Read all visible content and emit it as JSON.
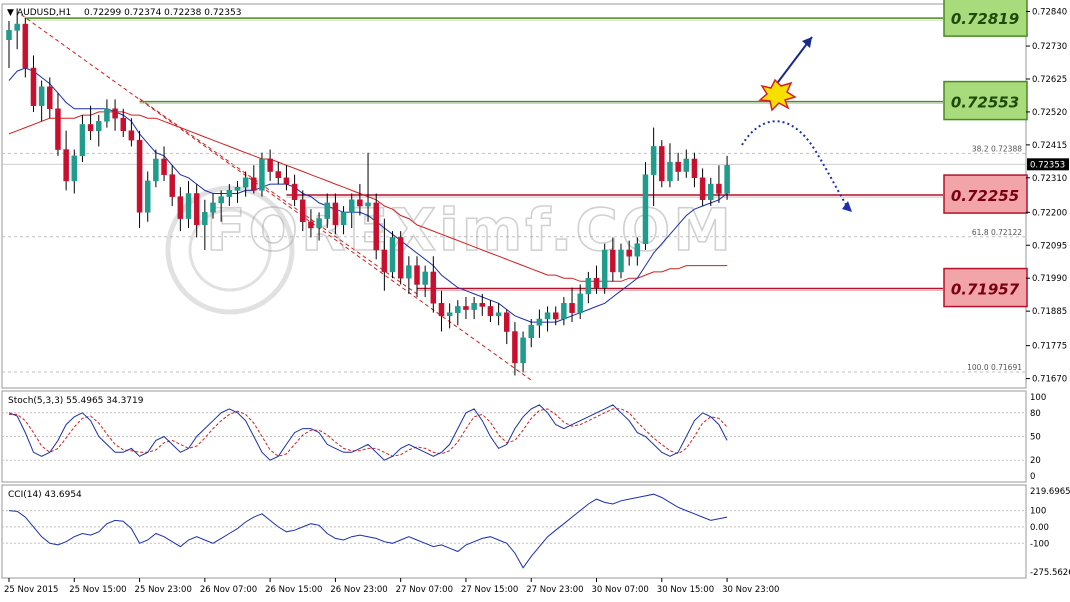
{
  "header": {
    "symbol": "AUDUSD,H1",
    "ohlc": "0.72299 0.72374 0.72238 0.72353"
  },
  "colors": {
    "bull_candle": "#1f9c8c",
    "bear_candle": "#c8102e",
    "ma_fast": "#1c2fae",
    "ma_slow": "#d42020",
    "resistance_line": "#4a8a1e",
    "resistance_box_fill": "#a8db7c",
    "support_line": "#b3122a",
    "support_box_fill": "#f2a5a8",
    "stoch_main": "#1c2fae",
    "stoch_signal": "#d42020",
    "cci_line": "#1c2fae",
    "arrow_up": "#1a2a8a",
    "arrow_down": "#1c2fae",
    "watermark": "#9a9a9a"
  },
  "levels": [
    {
      "label": "0.72819",
      "kind": "resistance"
    },
    {
      "label": "0.72553",
      "kind": "resistance"
    },
    {
      "label": "0.72255",
      "kind": "support"
    },
    {
      "label": "0.71957",
      "kind": "support"
    }
  ],
  "current_price": "0.72353",
  "fibonacci": [
    {
      "level": "38.2",
      "price": "0.72388"
    },
    {
      "level": "61.8",
      "price": "0.72122"
    },
    {
      "level": "100.0",
      "price": "0.71691"
    }
  ],
  "watermark": "FOREXimf.COM",
  "stoch": {
    "title": "Stoch(5,3,3) 55.4965 34.3719",
    "ticks": [
      "100",
      "80",
      "50",
      "20",
      "0"
    ]
  },
  "cci": {
    "title": "CCI(14) 43.6954",
    "ticks": [
      "219.6965",
      "100",
      "0.00",
      "-100",
      "-275.5626"
    ]
  },
  "chart_data": {
    "type": "line",
    "symbol": "AUDUSD",
    "timeframe": "H1",
    "price_ticks": [
      "0.72840",
      "0.72730",
      "0.72625",
      "0.72520",
      "0.72415",
      "0.72310",
      "0.72200",
      "0.72095",
      "0.71990",
      "0.71885",
      "0.71775",
      "0.71670"
    ],
    "ylim": [
      0.7164,
      0.72864
    ],
    "x_labels": [
      "25 Nov 2015",
      "25 Nov 15:00",
      "25 Nov 23:00",
      "26 Nov 07:00",
      "26 Nov 15:00",
      "26 Nov 23:00",
      "27 Nov 07:00",
      "27 Nov 15:00",
      "27 Nov 23:00",
      "30 Nov 07:00",
      "30 Nov 15:00",
      "30 Nov 23:00"
    ],
    "x_label_bars": [
      0,
      8,
      16,
      24,
      32,
      40,
      48,
      56,
      64,
      72,
      80,
      88
    ],
    "candles": [
      [
        0.7275,
        0.7281,
        0.7266,
        0.7278
      ],
      [
        0.7278,
        0.7285,
        0.7272,
        0.728
      ],
      [
        0.728,
        0.7282,
        0.7263,
        0.7266
      ],
      [
        0.7266,
        0.727,
        0.7252,
        0.7254
      ],
      [
        0.7254,
        0.7262,
        0.7249,
        0.726
      ],
      [
        0.726,
        0.7263,
        0.725,
        0.7253
      ],
      [
        0.7253,
        0.7258,
        0.7238,
        0.724
      ],
      [
        0.724,
        0.7246,
        0.7227,
        0.723
      ],
      [
        0.723,
        0.724,
        0.7226,
        0.7238
      ],
      [
        0.7238,
        0.7251,
        0.7236,
        0.7248
      ],
      [
        0.7248,
        0.7254,
        0.7243,
        0.7246
      ],
      [
        0.7246,
        0.7251,
        0.7241,
        0.7249
      ],
      [
        0.7249,
        0.7256,
        0.7247,
        0.7253
      ],
      [
        0.7253,
        0.7256,
        0.7246,
        0.725
      ],
      [
        0.725,
        0.7253,
        0.7244,
        0.7246
      ],
      [
        0.7246,
        0.725,
        0.7241,
        0.7243
      ],
      [
        0.7243,
        0.7246,
        0.7215,
        0.722
      ],
      [
        0.722,
        0.7233,
        0.7217,
        0.723
      ],
      [
        0.723,
        0.724,
        0.7228,
        0.7237
      ],
      [
        0.7237,
        0.7241,
        0.723,
        0.7232
      ],
      [
        0.7232,
        0.7235,
        0.7222,
        0.7225
      ],
      [
        0.7225,
        0.7228,
        0.7214,
        0.7218
      ],
      [
        0.7218,
        0.723,
        0.7215,
        0.7226
      ],
      [
        0.7226,
        0.7229,
        0.7212,
        0.7216
      ],
      [
        0.7216,
        0.7224,
        0.7208,
        0.722
      ],
      [
        0.722,
        0.7226,
        0.7218,
        0.7223
      ],
      [
        0.7223,
        0.7227,
        0.7217,
        0.7225
      ],
      [
        0.7225,
        0.7229,
        0.7222,
        0.7227
      ],
      [
        0.7227,
        0.723,
        0.7223,
        0.7228
      ],
      [
        0.7228,
        0.7233,
        0.7225,
        0.7231
      ],
      [
        0.7231,
        0.7235,
        0.7226,
        0.7227
      ],
      [
        0.7227,
        0.7239,
        0.7225,
        0.7237
      ],
      [
        0.7237,
        0.724,
        0.723,
        0.7233
      ],
      [
        0.7233,
        0.7236,
        0.7229,
        0.7231
      ],
      [
        0.7231,
        0.7235,
        0.7227,
        0.7229
      ],
      [
        0.7229,
        0.7232,
        0.7222,
        0.7224
      ],
      [
        0.7224,
        0.7227,
        0.7214,
        0.7217
      ],
      [
        0.7217,
        0.7221,
        0.7212,
        0.7215
      ],
      [
        0.7215,
        0.722,
        0.7211,
        0.7218
      ],
      [
        0.7218,
        0.7226,
        0.7215,
        0.7223
      ],
      [
        0.7223,
        0.7226,
        0.7213,
        0.7216
      ],
      [
        0.7216,
        0.7222,
        0.7213,
        0.722
      ],
      [
        0.722,
        0.7226,
        0.7215,
        0.7224
      ],
      [
        0.7224,
        0.7229,
        0.7219,
        0.7222
      ],
      [
        0.7222,
        0.7239,
        0.7217,
        0.7223
      ],
      [
        0.7223,
        0.7226,
        0.7205,
        0.7208
      ],
      [
        0.7208,
        0.7218,
        0.7195,
        0.7201
      ],
      [
        0.7201,
        0.7214,
        0.7199,
        0.7212
      ],
      [
        0.7212,
        0.7214,
        0.7197,
        0.7199
      ],
      [
        0.7199,
        0.7206,
        0.7194,
        0.7203
      ],
      [
        0.7203,
        0.7206,
        0.7193,
        0.7197
      ],
      [
        0.7197,
        0.7203,
        0.7193,
        0.7201
      ],
      [
        0.7201,
        0.7206,
        0.7188,
        0.7191
      ],
      [
        0.7191,
        0.7195,
        0.7182,
        0.7187
      ],
      [
        0.7187,
        0.7191,
        0.7183,
        0.7188
      ],
      [
        0.7188,
        0.7192,
        0.7184,
        0.719
      ],
      [
        0.719,
        0.7193,
        0.7186,
        0.7189
      ],
      [
        0.7189,
        0.7193,
        0.7186,
        0.7191
      ],
      [
        0.7191,
        0.7194,
        0.7187,
        0.719
      ],
      [
        0.719,
        0.7192,
        0.7185,
        0.7187
      ],
      [
        0.7187,
        0.7191,
        0.7184,
        0.7188
      ],
      [
        0.7188,
        0.7189,
        0.7178,
        0.7182
      ],
      [
        0.7182,
        0.7185,
        0.7168,
        0.7172
      ],
      [
        0.7172,
        0.7182,
        0.7169,
        0.718
      ],
      [
        0.718,
        0.7186,
        0.7177,
        0.7184
      ],
      [
        0.7184,
        0.7189,
        0.718,
        0.7186
      ],
      [
        0.7186,
        0.719,
        0.7182,
        0.7188
      ],
      [
        0.7188,
        0.719,
        0.7184,
        0.7186
      ],
      [
        0.7186,
        0.7193,
        0.7184,
        0.7191
      ],
      [
        0.7191,
        0.7196,
        0.7185,
        0.7188
      ],
      [
        0.7188,
        0.7197,
        0.7186,
        0.7194
      ],
      [
        0.7194,
        0.7201,
        0.7191,
        0.7199
      ],
      [
        0.7199,
        0.7203,
        0.7194,
        0.7196
      ],
      [
        0.7196,
        0.721,
        0.7194,
        0.7208
      ],
      [
        0.7208,
        0.7212,
        0.7198,
        0.7201
      ],
      [
        0.7201,
        0.721,
        0.7199,
        0.7208
      ],
      [
        0.7208,
        0.7211,
        0.7203,
        0.7206
      ],
      [
        0.7206,
        0.7212,
        0.7203,
        0.721
      ],
      [
        0.721,
        0.7236,
        0.7208,
        0.7232
      ],
      [
        0.7232,
        0.7247,
        0.7222,
        0.7241
      ],
      [
        0.7241,
        0.7243,
        0.7228,
        0.723
      ],
      [
        0.723,
        0.7242,
        0.7228,
        0.7236
      ],
      [
        0.7236,
        0.7239,
        0.723,
        0.7233
      ],
      [
        0.7233,
        0.724,
        0.7231,
        0.7237
      ],
      [
        0.7237,
        0.7239,
        0.7228,
        0.7231
      ],
      [
        0.7231,
        0.7234,
        0.7222,
        0.7224
      ],
      [
        0.7224,
        0.7231,
        0.7222,
        0.7229
      ],
      [
        0.7229,
        0.7235,
        0.7223,
        0.7226
      ],
      [
        0.7226,
        0.7238,
        0.7224,
        0.7235
      ]
    ],
    "ma_fast": [
      0.7262,
      0.7265,
      0.7266,
      0.7265,
      0.7263,
      0.7261,
      0.7258,
      0.7255,
      0.7253,
      0.7253,
      0.7253,
      0.7253,
      0.7253,
      0.7252,
      0.7251,
      0.7249,
      0.7245,
      0.7242,
      0.7239,
      0.7238,
      0.7235,
      0.7232,
      0.7231,
      0.7229,
      0.7227,
      0.7226,
      0.7226,
      0.7226,
      0.7226,
      0.7227,
      0.7227,
      0.7228,
      0.7229,
      0.7229,
      0.7229,
      0.7228,
      0.7226,
      0.7225,
      0.7223,
      0.7222,
      0.7221,
      0.722,
      0.722,
      0.722,
      0.7219,
      0.7217,
      0.7215,
      0.7213,
      0.7211,
      0.7209,
      0.7207,
      0.7205,
      0.7203,
      0.72,
      0.7198,
      0.7196,
      0.7195,
      0.7194,
      0.7193,
      0.7192,
      0.7191,
      0.7189,
      0.7187,
      0.7186,
      0.7185,
      0.7185,
      0.7185,
      0.7185,
      0.7186,
      0.7187,
      0.7188,
      0.7189,
      0.719,
      0.7191,
      0.7193,
      0.7195,
      0.7197,
      0.7199,
      0.7203,
      0.7207,
      0.721,
      0.7213,
      0.7216,
      0.7219,
      0.7221,
      0.7222,
      0.7223,
      0.7224,
      0.7226
    ],
    "ma_slow": [
      0.7245,
      0.7246,
      0.7247,
      0.7248,
      0.7249,
      0.725,
      0.725,
      0.725,
      0.725,
      0.7251,
      0.7251,
      0.7252,
      0.7252,
      0.7252,
      0.7252,
      0.7251,
      0.7251,
      0.725,
      0.725,
      0.7249,
      0.7248,
      0.7247,
      0.7246,
      0.7245,
      0.7244,
      0.7243,
      0.7242,
      0.7241,
      0.724,
      0.7239,
      0.7238,
      0.7237,
      0.7237,
      0.7236,
      0.7235,
      0.7234,
      0.7233,
      0.7232,
      0.7231,
      0.723,
      0.7229,
      0.7228,
      0.7227,
      0.7226,
      0.7225,
      0.7224,
      0.7222,
      0.7221,
      0.7219,
      0.7218,
      0.7216,
      0.7215,
      0.7214,
      0.7213,
      0.7212,
      0.7211,
      0.721,
      0.7209,
      0.7208,
      0.7207,
      0.7206,
      0.7205,
      0.7204,
      0.7203,
      0.7202,
      0.7201,
      0.72,
      0.72,
      0.7199,
      0.7199,
      0.7198,
      0.7198,
      0.7198,
      0.7198,
      0.7198,
      0.7198,
      0.7199,
      0.7199,
      0.72,
      0.7201,
      0.7201,
      0.7202,
      0.7202,
      0.7203,
      0.7203,
      0.7203,
      0.7203,
      0.7203,
      0.7203
    ],
    "stoch_main": [
      80,
      76,
      55,
      30,
      25,
      30,
      45,
      65,
      75,
      80,
      70,
      50,
      40,
      30,
      30,
      35,
      25,
      30,
      45,
      50,
      40,
      30,
      35,
      50,
      60,
      70,
      80,
      85,
      80,
      70,
      50,
      30,
      20,
      25,
      40,
      55,
      60,
      60,
      55,
      40,
      35,
      30,
      30,
      35,
      40,
      30,
      20,
      25,
      35,
      40,
      35,
      30,
      25,
      30,
      40,
      60,
      80,
      85,
      70,
      50,
      35,
      40,
      60,
      75,
      85,
      90,
      80,
      65,
      60,
      65,
      70,
      75,
      80,
      85,
      90,
      80,
      70,
      55,
      50,
      40,
      30,
      25,
      30,
      50,
      70,
      80,
      75,
      65,
      45
    ],
    "stoch_signal": [
      78,
      78,
      70,
      55,
      38,
      30,
      35,
      48,
      62,
      73,
      76,
      67,
      53,
      40,
      33,
      32,
      30,
      30,
      33,
      42,
      45,
      40,
      35,
      38,
      48,
      60,
      70,
      78,
      82,
      78,
      67,
      50,
      33,
      25,
      28,
      40,
      52,
      58,
      58,
      52,
      43,
      35,
      32,
      32,
      35,
      35,
      30,
      25,
      27,
      33,
      37,
      35,
      30,
      28,
      32,
      43,
      60,
      75,
      78,
      68,
      52,
      42,
      45,
      58,
      73,
      83,
      85,
      78,
      68,
      63,
      65,
      70,
      75,
      80,
      85,
      85,
      80,
      68,
      58,
      48,
      40,
      32,
      28,
      35,
      50,
      67,
      75,
      73,
      62
    ],
    "cci": [
      100,
      95,
      60,
      0,
      -60,
      -100,
      -110,
      -90,
      -60,
      -40,
      -50,
      -30,
      20,
      40,
      35,
      -10,
      -100,
      -80,
      -40,
      -60,
      -90,
      -120,
      -80,
      -60,
      -80,
      -100,
      -70,
      -40,
      -10,
      30,
      60,
      80,
      40,
      0,
      -30,
      -20,
      0,
      20,
      10,
      -40,
      -70,
      -80,
      -60,
      -50,
      -60,
      -70,
      -90,
      -100,
      -80,
      -60,
      -80,
      -100,
      -120,
      -110,
      -130,
      -150,
      -110,
      -90,
      -70,
      -60,
      -80,
      -100,
      -160,
      -250,
      -180,
      -120,
      -60,
      -20,
      20,
      60,
      100,
      140,
      170,
      150,
      140,
      160,
      170,
      180,
      190,
      200,
      180,
      150,
      120,
      100,
      80,
      60,
      40,
      50,
      60
    ],
    "stoch_ylim": [
      0,
      100
    ],
    "cci_ylim": [
      -275.5626,
      219.6965
    ],
    "annotations": [
      "38.2 0.72388",
      "61.8 0.72122",
      "100.0 0.71691"
    ]
  }
}
